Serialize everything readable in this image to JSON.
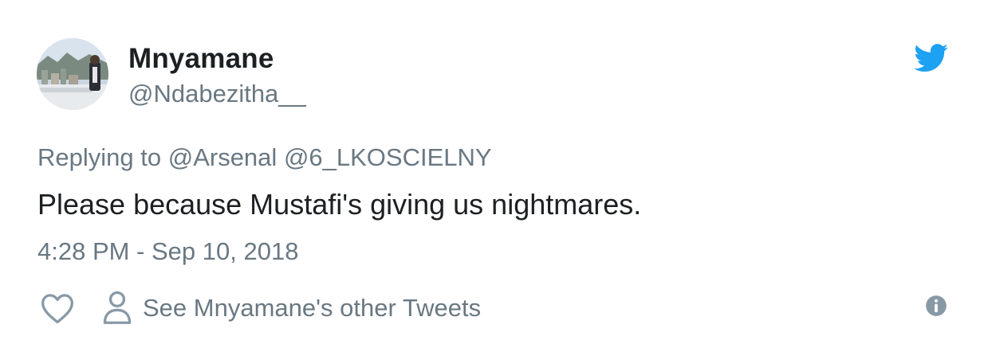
{
  "author": {
    "display_name": "Mnyamane",
    "handle": "@Ndabezitha__"
  },
  "reply": {
    "prefix": "Replying to",
    "mentions": [
      "@Arsenal",
      "@6_LKOSCIELNY"
    ]
  },
  "tweet": {
    "text": "Please because Mustafi's giving us nightmares.",
    "timestamp": "4:28 PM - Sep 10, 2018"
  },
  "actions": {
    "see_tweets_label": "See Mnyamane's other Tweets"
  },
  "icons": {
    "brand": "twitter-bird-icon",
    "like": "heart-icon",
    "profile": "person-icon",
    "info": "info-icon"
  },
  "colors": {
    "brand_blue": "#1da1f2",
    "text_primary": "#1c2022",
    "text_secondary": "#697882",
    "icon_gray": "#8899a6"
  }
}
